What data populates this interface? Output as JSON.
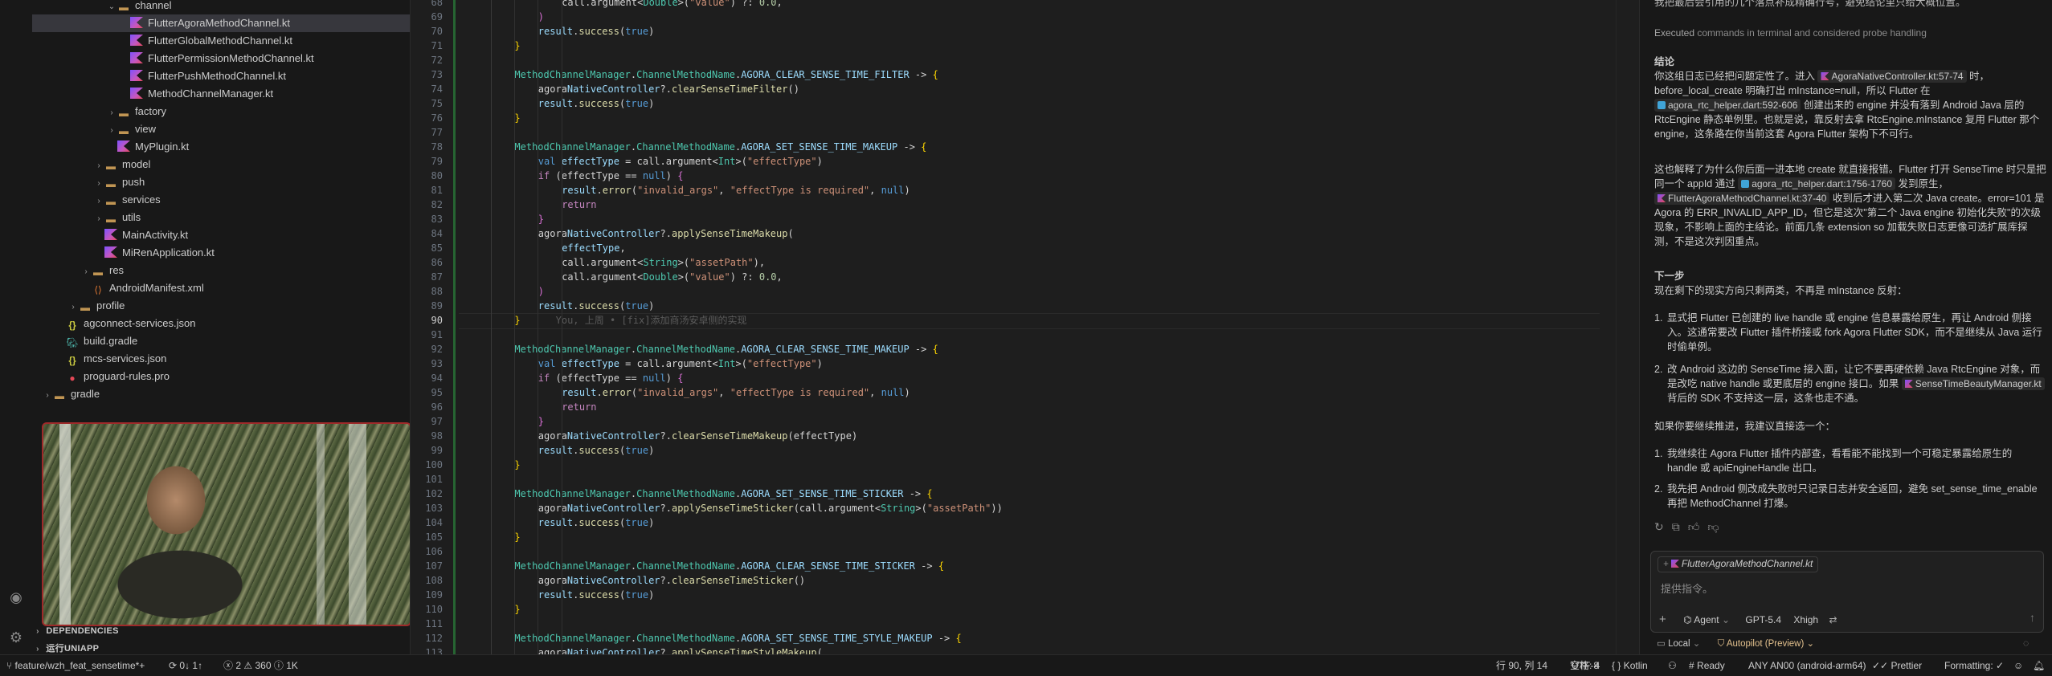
{
  "sidebar": {
    "tree": [
      {
        "label": "channel",
        "type": "folder",
        "open": true,
        "depth": 3
      },
      {
        "label": "FlutterAgoraMethodChannel.kt",
        "type": "kt",
        "depth": 4,
        "selected": true,
        "badge": "M"
      },
      {
        "label": "FlutterGlobalMethodChannel.kt",
        "type": "kt",
        "depth": 4
      },
      {
        "label": "FlutterPermissionMethodChannel.kt",
        "type": "kt",
        "depth": 4
      },
      {
        "label": "FlutterPushMethodChannel.kt",
        "type": "kt",
        "depth": 4
      },
      {
        "label": "MethodChannelManager.kt",
        "type": "kt",
        "depth": 4
      },
      {
        "label": "factory",
        "type": "folder",
        "open": false,
        "depth": 3
      },
      {
        "label": "view",
        "type": "folder",
        "open": false,
        "depth": 3
      },
      {
        "label": "MyPlugin.kt",
        "type": "kt",
        "depth": 3
      },
      {
        "label": "model",
        "type": "folder",
        "open": false,
        "depth": 2
      },
      {
        "label": "push",
        "type": "folder",
        "open": false,
        "depth": 2
      },
      {
        "label": "services",
        "type": "folder",
        "open": false,
        "depth": 2
      },
      {
        "label": "utils",
        "type": "folder",
        "open": false,
        "depth": 2
      },
      {
        "label": "MainActivity.kt",
        "type": "kt",
        "depth": 2
      },
      {
        "label": "MiRenApplication.kt",
        "type": "kt",
        "depth": 2
      },
      {
        "label": "res",
        "type": "folder",
        "open": false,
        "depth": 1
      },
      {
        "label": "AndroidManifest.xml",
        "type": "xml",
        "depth": 1
      },
      {
        "label": "profile",
        "type": "folder",
        "open": false,
        "depth": 0
      },
      {
        "label": "agconnect-services.json",
        "type": "json",
        "depth": -1
      },
      {
        "label": "build.gradle",
        "type": "gradle",
        "depth": -1
      },
      {
        "label": "mcs-services.json",
        "type": "json",
        "depth": -1
      },
      {
        "label": "proguard-rules.pro",
        "type": "pro",
        "depth": -1
      },
      {
        "label": "gradle",
        "type": "folder",
        "open": false,
        "depth": -2
      }
    ],
    "sections": {
      "dependencies": "DEPENDENCIES",
      "uniapp": "运行UNIAPP"
    }
  },
  "editor": {
    "blame": "You, 上周 • [fix]添加商汤安卓侧的实现",
    "current_line": 90,
    "lines": [
      {
        "n": 68,
        "i": 3,
        "t": [
          [
            "call.argument<"
          ],
          [
            "Double",
            "ty"
          ],
          [
            ">("
          ],
          [
            "\"value\"",
            "str"
          ],
          [
            ") ?: "
          ],
          [
            "0.0",
            "num"
          ],
          [
            ","
          ]
        ]
      },
      {
        "n": 69,
        "i": 2,
        "t": [
          [
            ")",
            "brk2"
          ]
        ]
      },
      {
        "n": 70,
        "i": 2,
        "t": [
          [
            "result",
            "prop"
          ],
          [
            "."
          ],
          [
            "success",
            "fn"
          ],
          [
            "("
          ],
          [
            "true",
            "kw2"
          ],
          [
            ")"
          ]
        ]
      },
      {
        "n": 71,
        "i": 1,
        "t": [
          [
            "}",
            "brk1"
          ]
        ]
      },
      {
        "n": 72,
        "i": 0,
        "t": []
      },
      {
        "n": 73,
        "i": 1,
        "t": [
          [
            "MethodChannelManager",
            "cls"
          ],
          [
            "."
          ],
          [
            "ChannelMethodName",
            "cls"
          ],
          [
            "."
          ],
          [
            "AGORA_CLEAR_SENSE_TIME_FILTER",
            "prop"
          ],
          [
            " -> "
          ],
          [
            "{",
            "brk1"
          ]
        ]
      },
      {
        "n": 74,
        "i": 2,
        "t": [
          [
            "agora"
          ],
          [
            "NativeController",
            "prop"
          ],
          [
            "?."
          ],
          [
            "clearSenseTimeFilter",
            "fn"
          ],
          [
            "()"
          ]
        ]
      },
      {
        "n": 75,
        "i": 2,
        "t": [
          [
            "result",
            "prop"
          ],
          [
            "."
          ],
          [
            "success",
            "fn"
          ],
          [
            "("
          ],
          [
            "true",
            "kw2"
          ],
          [
            ")"
          ]
        ]
      },
      {
        "n": 76,
        "i": 1,
        "t": [
          [
            "}",
            "brk1"
          ]
        ]
      },
      {
        "n": 77,
        "i": 0,
        "t": []
      },
      {
        "n": 78,
        "i": 1,
        "t": [
          [
            "MethodChannelManager",
            "cls"
          ],
          [
            "."
          ],
          [
            "ChannelMethodName",
            "cls"
          ],
          [
            "."
          ],
          [
            "AGORA_SET_SENSE_TIME_MAKEUP",
            "prop"
          ],
          [
            " -> "
          ],
          [
            "{",
            "brk1"
          ]
        ]
      },
      {
        "n": 79,
        "i": 2,
        "t": [
          [
            "val ",
            "kw2"
          ],
          [
            "effectType",
            "prop"
          ],
          [
            " = call.argument<"
          ],
          [
            "Int",
            "ty"
          ],
          [
            ">("
          ],
          [
            "\"effectType\"",
            "str"
          ],
          [
            ")"
          ]
        ]
      },
      {
        "n": 80,
        "i": 2,
        "t": [
          [
            "if ",
            "kw"
          ],
          [
            "(effectType == "
          ],
          [
            "null",
            "kw2"
          ],
          [
            ") "
          ],
          [
            "{",
            "brk2"
          ]
        ]
      },
      {
        "n": 81,
        "i": 3,
        "t": [
          [
            "result",
            "prop"
          ],
          [
            "."
          ],
          [
            "error",
            "fn"
          ],
          [
            "("
          ],
          [
            "\"invalid_args\"",
            "str"
          ],
          [
            ", "
          ],
          [
            "\"effectType is required\"",
            "str"
          ],
          [
            ", "
          ],
          [
            "null",
            "kw2"
          ],
          [
            ")"
          ]
        ]
      },
      {
        "n": 82,
        "i": 3,
        "t": [
          [
            "return",
            "kw"
          ]
        ]
      },
      {
        "n": 83,
        "i": 2,
        "t": [
          [
            "}",
            "brk2"
          ]
        ]
      },
      {
        "n": 84,
        "i": 2,
        "t": [
          [
            "agora"
          ],
          [
            "NativeController",
            "prop"
          ],
          [
            "?."
          ],
          [
            "applySenseTimeMakeup",
            "fn"
          ],
          [
            "("
          ]
        ]
      },
      {
        "n": 85,
        "i": 3,
        "t": [
          [
            "effectType",
            "prop"
          ],
          [
            ","
          ]
        ]
      },
      {
        "n": 86,
        "i": 3,
        "t": [
          [
            "call.argument<"
          ],
          [
            "String",
            "ty"
          ],
          [
            ">("
          ],
          [
            "\"assetPath\"",
            "str"
          ],
          [
            "),"
          ]
        ]
      },
      {
        "n": 87,
        "i": 3,
        "t": [
          [
            "call.argument<"
          ],
          [
            "Double",
            "ty"
          ],
          [
            ">("
          ],
          [
            "\"value\"",
            "str"
          ],
          [
            ") ?: "
          ],
          [
            "0.0",
            "num"
          ],
          [
            ","
          ]
        ]
      },
      {
        "n": 88,
        "i": 2,
        "t": [
          [
            ")",
            "brk2"
          ]
        ]
      },
      {
        "n": 89,
        "i": 2,
        "t": [
          [
            "result",
            "prop"
          ],
          [
            "."
          ],
          [
            "success",
            "fn"
          ],
          [
            "("
          ],
          [
            "true",
            "kw2"
          ],
          [
            ")"
          ]
        ]
      },
      {
        "n": 90,
        "i": 1,
        "t": [
          [
            "}",
            "brk1"
          ]
        ],
        "blame": true
      },
      {
        "n": 91,
        "i": 0,
        "t": []
      },
      {
        "n": 92,
        "i": 1,
        "t": [
          [
            "MethodChannelManager",
            "cls"
          ],
          [
            "."
          ],
          [
            "ChannelMethodName",
            "cls"
          ],
          [
            "."
          ],
          [
            "AGORA_CLEAR_SENSE_TIME_MAKEUP",
            "prop"
          ],
          [
            " -> "
          ],
          [
            "{",
            "brk1"
          ]
        ]
      },
      {
        "n": 93,
        "i": 2,
        "t": [
          [
            "val ",
            "kw2"
          ],
          [
            "effectType",
            "prop"
          ],
          [
            " = call.argument<"
          ],
          [
            "Int",
            "ty"
          ],
          [
            ">("
          ],
          [
            "\"effectType\"",
            "str"
          ],
          [
            ")"
          ]
        ]
      },
      {
        "n": 94,
        "i": 2,
        "t": [
          [
            "if ",
            "kw"
          ],
          [
            "(effectType == "
          ],
          [
            "null",
            "kw2"
          ],
          [
            ") "
          ],
          [
            "{",
            "brk2"
          ]
        ]
      },
      {
        "n": 95,
        "i": 3,
        "t": [
          [
            "result",
            "prop"
          ],
          [
            "."
          ],
          [
            "error",
            "fn"
          ],
          [
            "("
          ],
          [
            "\"invalid_args\"",
            "str"
          ],
          [
            ", "
          ],
          [
            "\"effectType is required\"",
            "str"
          ],
          [
            ", "
          ],
          [
            "null",
            "kw2"
          ],
          [
            ")"
          ]
        ]
      },
      {
        "n": 96,
        "i": 3,
        "t": [
          [
            "return",
            "kw"
          ]
        ]
      },
      {
        "n": 97,
        "i": 2,
        "t": [
          [
            "}",
            "brk2"
          ]
        ]
      },
      {
        "n": 98,
        "i": 2,
        "t": [
          [
            "agora"
          ],
          [
            "NativeController",
            "prop"
          ],
          [
            "?."
          ],
          [
            "clearSenseTimeMakeup",
            "fn"
          ],
          [
            "(effectType)"
          ]
        ]
      },
      {
        "n": 99,
        "i": 2,
        "t": [
          [
            "result",
            "prop"
          ],
          [
            "."
          ],
          [
            "success",
            "fn"
          ],
          [
            "("
          ],
          [
            "true",
            "kw2"
          ],
          [
            ")"
          ]
        ]
      },
      {
        "n": 100,
        "i": 1,
        "t": [
          [
            "}",
            "brk1"
          ]
        ]
      },
      {
        "n": 101,
        "i": 0,
        "t": []
      },
      {
        "n": 102,
        "i": 1,
        "t": [
          [
            "MethodChannelManager",
            "cls"
          ],
          [
            "."
          ],
          [
            "ChannelMethodName",
            "cls"
          ],
          [
            "."
          ],
          [
            "AGORA_SET_SENSE_TIME_STICKER",
            "prop"
          ],
          [
            " -> "
          ],
          [
            "{",
            "brk1"
          ]
        ]
      },
      {
        "n": 103,
        "i": 2,
        "t": [
          [
            "agora"
          ],
          [
            "NativeController",
            "prop"
          ],
          [
            "?."
          ],
          [
            "applySenseTimeSticker",
            "fn"
          ],
          [
            "(call.argument<"
          ],
          [
            "String",
            "ty"
          ],
          [
            ">("
          ],
          [
            "\"assetPath\"",
            "str"
          ],
          [
            "))"
          ]
        ]
      },
      {
        "n": 104,
        "i": 2,
        "t": [
          [
            "result",
            "prop"
          ],
          [
            "."
          ],
          [
            "success",
            "fn"
          ],
          [
            "("
          ],
          [
            "true",
            "kw2"
          ],
          [
            ")"
          ]
        ]
      },
      {
        "n": 105,
        "i": 1,
        "t": [
          [
            "}",
            "brk1"
          ]
        ]
      },
      {
        "n": 106,
        "i": 0,
        "t": []
      },
      {
        "n": 107,
        "i": 1,
        "t": [
          [
            "MethodChannelManager",
            "cls"
          ],
          [
            "."
          ],
          [
            "ChannelMethodName",
            "cls"
          ],
          [
            "."
          ],
          [
            "AGORA_CLEAR_SENSE_TIME_STICKER",
            "prop"
          ],
          [
            " -> "
          ],
          [
            "{",
            "brk1"
          ]
        ]
      },
      {
        "n": 108,
        "i": 2,
        "t": [
          [
            "agora"
          ],
          [
            "NativeController",
            "prop"
          ],
          [
            "?."
          ],
          [
            "clearSenseTimeSticker",
            "fn"
          ],
          [
            "()"
          ]
        ]
      },
      {
        "n": 109,
        "i": 2,
        "t": [
          [
            "result",
            "prop"
          ],
          [
            "."
          ],
          [
            "success",
            "fn"
          ],
          [
            "("
          ],
          [
            "true",
            "kw2"
          ],
          [
            ")"
          ]
        ]
      },
      {
        "n": 110,
        "i": 1,
        "t": [
          [
            "}",
            "brk1"
          ]
        ]
      },
      {
        "n": 111,
        "i": 0,
        "t": []
      },
      {
        "n": 112,
        "i": 1,
        "t": [
          [
            "MethodChannelManager",
            "cls"
          ],
          [
            "."
          ],
          [
            "ChannelMethodName",
            "cls"
          ],
          [
            "."
          ],
          [
            "AGORA_SET_SENSE_TIME_STYLE_MAKEUP",
            "prop"
          ],
          [
            " -> "
          ],
          [
            "{",
            "brk1"
          ]
        ]
      },
      {
        "n": 113,
        "i": 2,
        "t": [
          [
            "agora"
          ],
          [
            "NativeController",
            "prop"
          ],
          [
            "?."
          ],
          [
            "applySenseTimeStyleMakeup",
            "fn"
          ],
          [
            "("
          ]
        ]
      }
    ]
  },
  "chat": {
    "top_line": "我把最后会引用的几个落点补成精确行号，避免结论里只给大概位置。",
    "executed": {
      "prefix": "Executed",
      "rest": " commands in terminal and considered probe handling"
    },
    "conclusion_title": "结论",
    "p1": {
      "a": "你这组日志已经把问题定性了。进入 ",
      "chip1": "AgoraNativeController.kt:57-74",
      "b": " 时，before_local_create 明确打出 mInstance=null，所以 Flutter 在 ",
      "chip2": "agora_rtc_helper.dart:592-606",
      "c": " 创建出来的 engine 并没有落到 Android Java 层的 RtcEngine 静态单例里。也就是说，靠反射去拿 RtcEngine.mInstance 复用 Flutter 那个 engine，这条路在你当前这套 Agora Flutter 架构下不可行。"
    },
    "p2": {
      "a": "这也解释了为什么你后面一进本地 create 就直接报错。Flutter 打开 SenseTime 时只是把同一个 appId 通过 ",
      "chip1": "agora_rtc_helper.dart:1756-1760",
      "b": " 发到原生，",
      "chip2": "FlutterAgoraMethodChannel.kt:37-40",
      "c": " 收到后才进入第二次 Java create。error=101 是 Agora 的 ERR_INVALID_APP_ID，但它是这次\"第二个 Java engine 初始化失败\"的次级现象，不影响上面的主结论。前面几条 extension so 加载失败日志更像可选扩展库探测，不是这次判因重点。"
    },
    "next_title": "下一步",
    "next_intro": "现在剩下的现实方向只剩两类，不再是 mInstance 反射：",
    "list1": [
      "显式把 Flutter 已创建的 live handle 或 engine 信息暴露给原生，再让 Android 侧接入。这通常要改 Flutter 插件桥接或 fork Agora Flutter SDK，而不是继续从 Java 运行时偷单例。",
      {
        "a": "改 Android 这边的 SenseTime 接入面，让它不要再硬依赖 Java RtcEngine 对象，而是改吃 native handle 或更底层的 engine 接口。如果 ",
        "chip": "SenseTimeBeautyManager.kt",
        "b": " 背后的 SDK 不支持这一层，这条也走不通。"
      }
    ],
    "followup": "如果你要继续推进，我建议直接选一个：",
    "list2": [
      "我继续往 Agora Flutter 插件内部查，看看能不能找到一个可稳定暴露给原生的 handle 或 apiEngineHandle 出口。",
      "我先把 Android 侧改成失败时只记录日志并安全返回，避免 set_sense_time_enable 再把 MethodChannel 打爆。"
    ],
    "input": {
      "context_file": "FlutterAgoraMethodChannel.kt",
      "placeholder": "提供指令。",
      "agent_label": "Agent",
      "model_label": "GPT-5.4",
      "effort_label": "Xhigh",
      "local_label": "Local",
      "autopilot_label": "Autopilot (Preview)"
    }
  },
  "status": {
    "branch": "feature/wzh_feat_sensetime*+",
    "sync": "0↓ 1↑",
    "errors": "2",
    "warnings": "360",
    "info": "1K",
    "position": "行 90, 列 14",
    "spaces": "空格: 4",
    "encoding": "UTF-8",
    "language": "Kotlin",
    "ready": "Ready",
    "device": "ANY AN00 (android-arm64)",
    "prettier": "Prettier",
    "formatting": "Formatting: ✓"
  },
  "colors": {
    "accent": "#0078d4",
    "kotlin_purple": "#7f52ff",
    "modified": "#e2c08d",
    "git_added": "#2ea043"
  }
}
